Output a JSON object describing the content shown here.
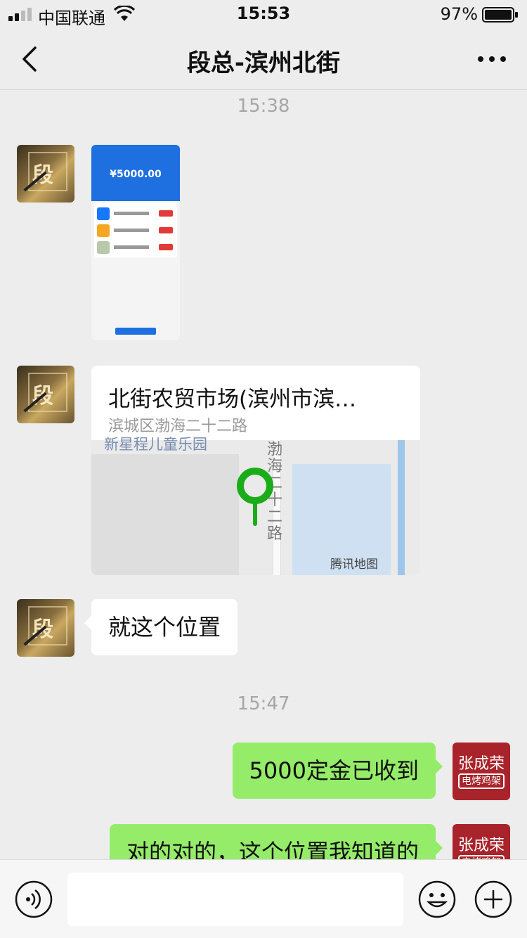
{
  "status_bar": {
    "carrier": "中国联通",
    "time": "15:53",
    "battery": "97%"
  },
  "header": {
    "title": "段总-滨州北街"
  },
  "chat": {
    "timestamps": [
      "15:38",
      "15:47"
    ],
    "screenshot_image": {
      "amount": "¥5000.00"
    },
    "location": {
      "title": "北街农贸市场(滨州市滨…",
      "address": "滨城区渤海二十二路",
      "map_top_label": "新星程儿童乐园",
      "map_road_label": "渤海二十二路",
      "map_provider": "腾讯地图"
    },
    "messages": [
      {
        "side": "left",
        "text": "就这个位置"
      },
      {
        "side": "right",
        "text": "5000定金已收到"
      },
      {
        "side": "right",
        "text": "对的对的，这个位置我知道的"
      }
    ]
  },
  "avatars": {
    "contact_glyph": "段",
    "me_name": "张成荣",
    "me_sub": "电烤鸡架"
  },
  "input": {
    "placeholder": ""
  },
  "colors": {
    "background": "#ededed",
    "sent_bubble": "#95ec69",
    "received_bubble": "#ffffff",
    "pin": "#1aad19"
  },
  "icons": [
    "signal-icon",
    "wifi-icon",
    "battery-icon",
    "back-icon",
    "more-icon",
    "voice-icon",
    "emoji-icon",
    "plus-icon"
  ]
}
